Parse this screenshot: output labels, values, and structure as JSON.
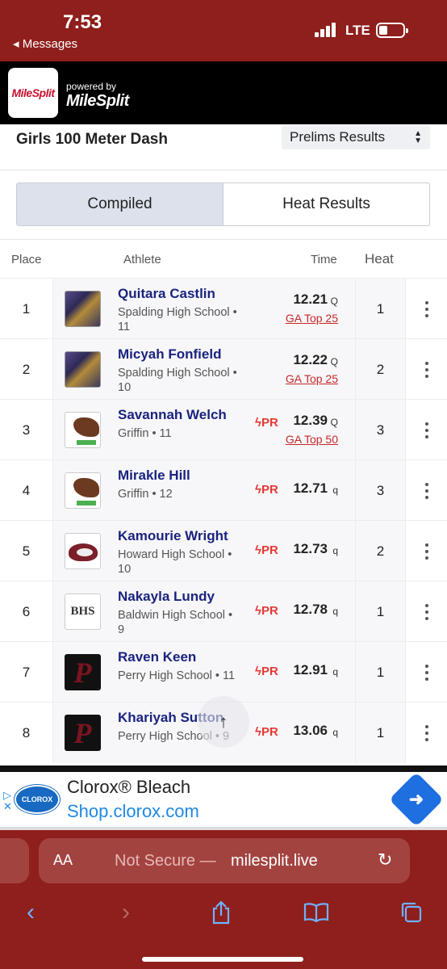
{
  "status": {
    "time": "7:53",
    "back_label": "◂ Messages",
    "network": "LTE"
  },
  "header": {
    "logo_text": "MileSplit",
    "powered_by": "powered by",
    "powered_brand": "MileSplit"
  },
  "event": {
    "title": "Girls 100 Meter Dash",
    "round_selected": "Prelims Results"
  },
  "tabs": [
    {
      "label": "Compiled",
      "active": true
    },
    {
      "label": "Heat Results",
      "active": false
    }
  ],
  "table": {
    "headers": {
      "place": "Place",
      "athlete": "Athlete",
      "time": "Time",
      "heat": "Heat"
    },
    "rows": [
      {
        "place": "1",
        "name": "Quitara Castlin",
        "school": "Spalding High School • 11",
        "pr": "",
        "time": "12.21",
        "qual": "Q",
        "rank": "GA Top 25",
        "heat": "1",
        "logo": "jaguar"
      },
      {
        "place": "2",
        "name": "Micyah Fonfield",
        "school": "Spalding High School • 10",
        "pr": "",
        "time": "12.22",
        "qual": "Q",
        "rank": "GA Top 25",
        "heat": "2",
        "logo": "jaguar"
      },
      {
        "place": "3",
        "name": "Savannah Welch",
        "school": "Griffin • 11",
        "pr": "ϟPR",
        "time": "12.39",
        "qual": "Q",
        "rank": "GA Top 50",
        "heat": "3",
        "logo": "eagle"
      },
      {
        "place": "4",
        "name": "Mirakle Hill",
        "school": "Griffin • 12",
        "pr": "ϟPR",
        "time": "12.71",
        "qual": "q",
        "rank": "",
        "heat": "3",
        "logo": "eagle"
      },
      {
        "place": "5",
        "name": "Kamourie Wright",
        "school": "Howard High School • 10",
        "pr": "ϟPR",
        "time": "12.73",
        "qual": "q",
        "rank": "",
        "heat": "2",
        "logo": "husky"
      },
      {
        "place": "6",
        "name": "Nakayla Lundy",
        "school": "Baldwin High School • 9",
        "pr": "ϟPR",
        "time": "12.78",
        "qual": "q",
        "rank": "",
        "heat": "1",
        "logo": "bhs"
      },
      {
        "place": "7",
        "name": "Raven Keen",
        "school": "Perry High School • 11",
        "pr": "ϟPR",
        "time": "12.91",
        "qual": "q",
        "rank": "",
        "heat": "1",
        "logo": "perry"
      },
      {
        "place": "8",
        "name": "Khariyah Sutton",
        "school": "Perry High School • 9",
        "pr": "ϟPR",
        "time": "13.06",
        "qual": "q",
        "rank": "",
        "heat": "1",
        "logo": "perry"
      }
    ]
  },
  "ad": {
    "brand_logo": "CLOROX",
    "title": "Clorox® Bleach",
    "url": "Shop.clorox.com"
  },
  "browser": {
    "aa_label": "AA",
    "not_secure": "Not Secure —",
    "domain": "milesplit.live"
  },
  "colors": {
    "chrome": "#8e1f1c",
    "name_blue": "#1a237e",
    "pr_red": "#e53935",
    "rank_red": "#c62828"
  }
}
